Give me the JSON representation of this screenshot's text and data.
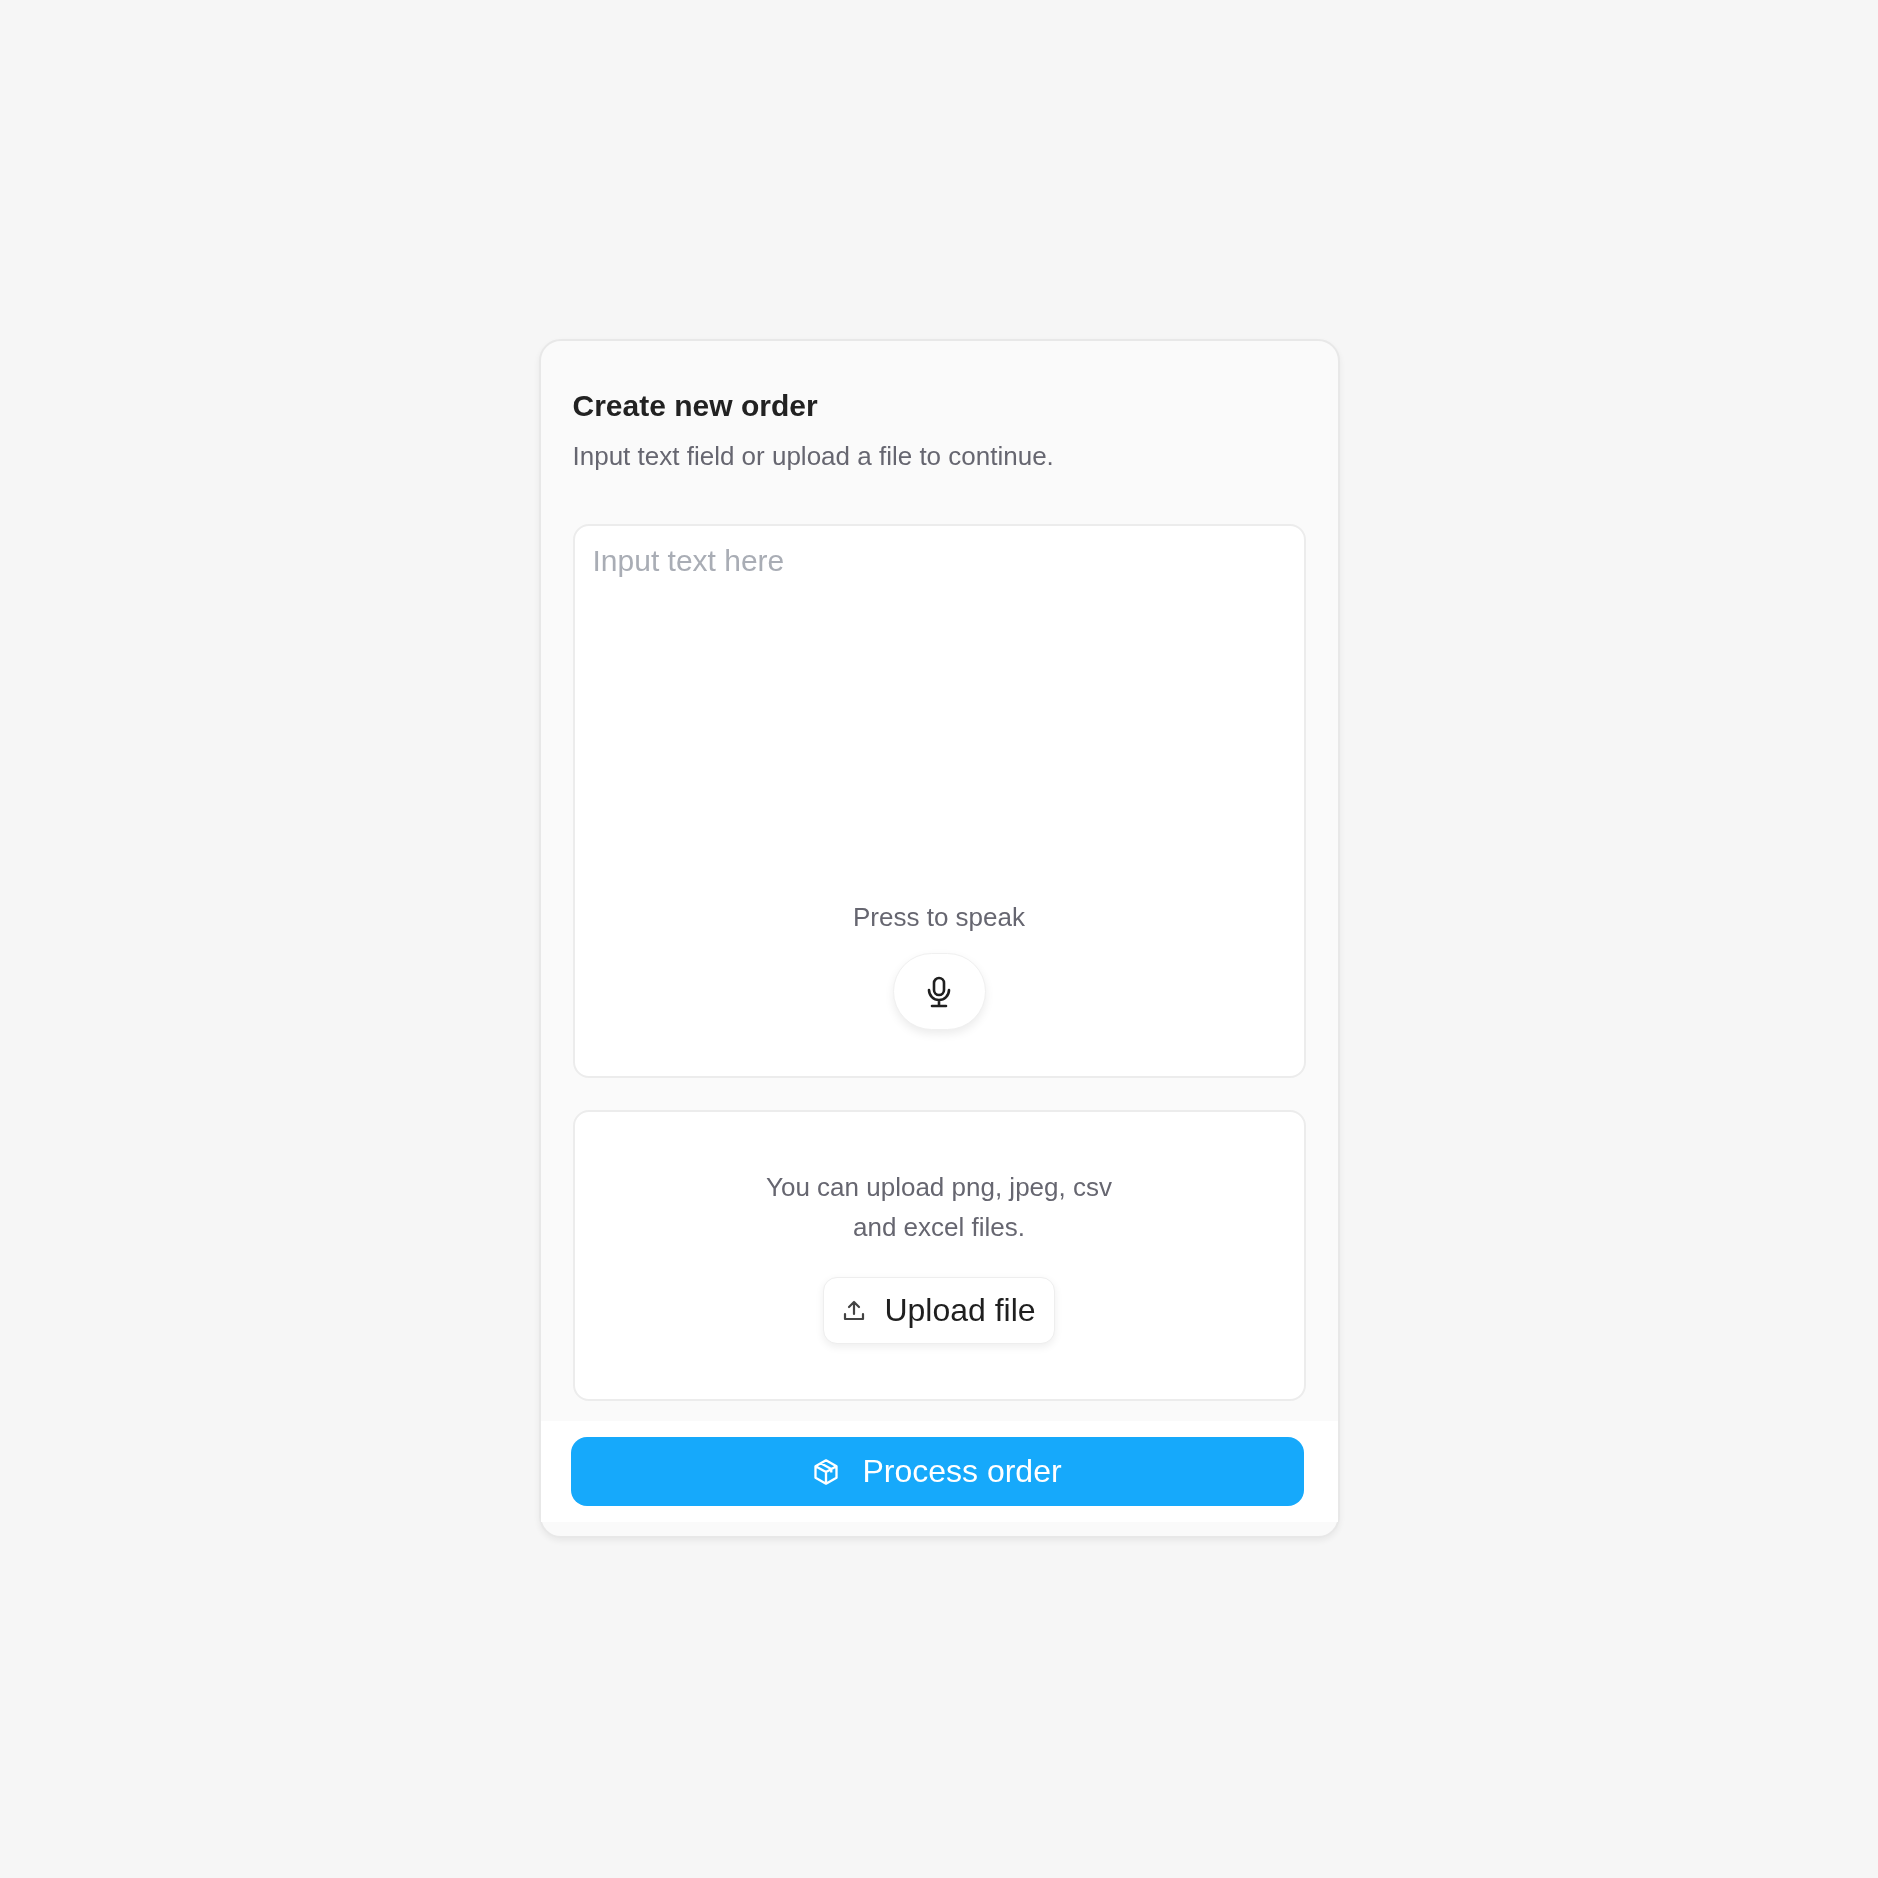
{
  "card": {
    "title": "Create new order",
    "subtitle": "Input text field or upload a file to continue."
  },
  "text_input": {
    "placeholder": "Input text here"
  },
  "voice": {
    "label": "Press to speak"
  },
  "upload": {
    "hint": "You can upload png, jpeg, csv and excel files.",
    "button": "Upload file"
  },
  "process_button": {
    "label": "Process order"
  }
}
